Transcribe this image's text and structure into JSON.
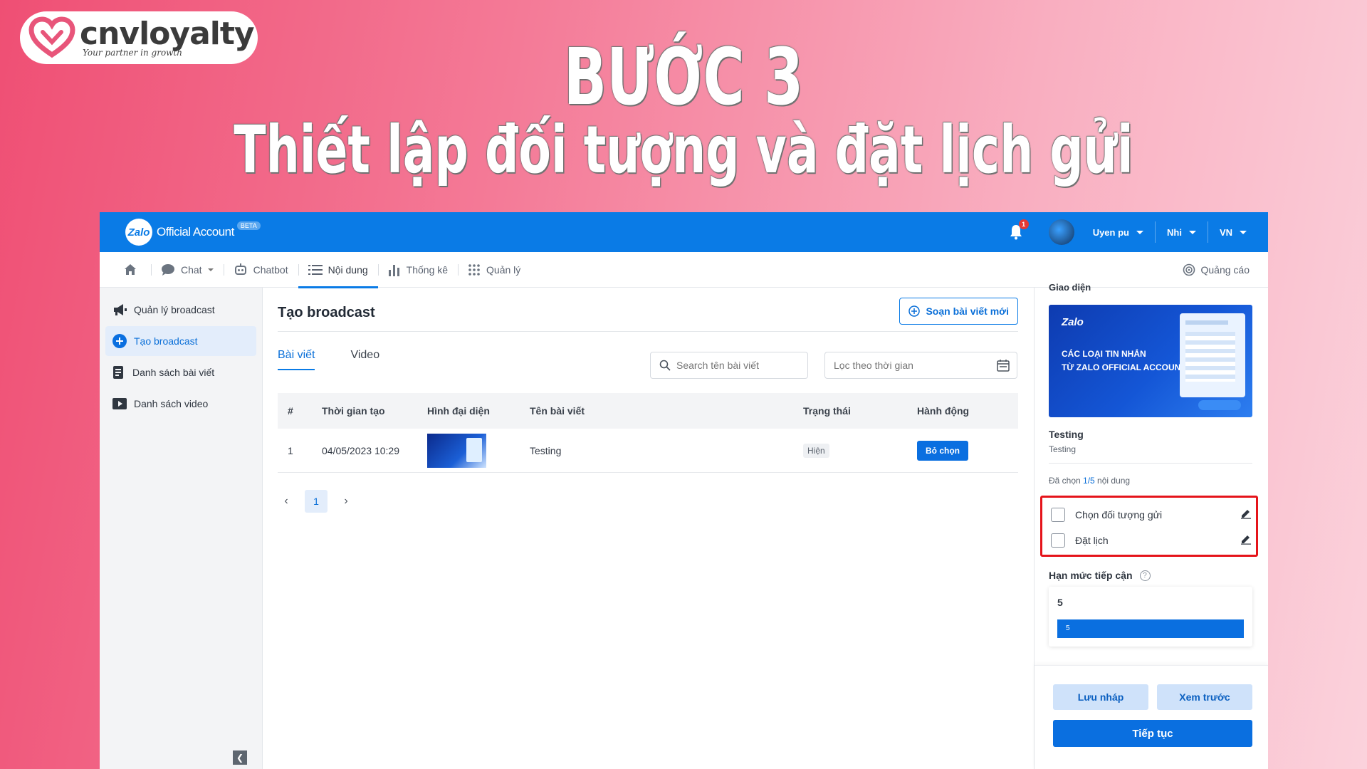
{
  "brand": {
    "name": "cnvloyalty",
    "tagline": "Your partner in growth",
    "accent": "#e8557a"
  },
  "headline": {
    "step": "BƯỚC 3",
    "subtitle": "Thiết lập đối tượng và đặt lịch gửi"
  },
  "app": {
    "topbar": {
      "logo_text": "Zalo",
      "brand_label": "Official Account",
      "beta": "BETA",
      "notification_count": "1",
      "user_name": "Uyen pu",
      "account": "Nhi",
      "language": "VN",
      "color": "#0a7be6"
    },
    "nav": {
      "items": [
        {
          "label": "Chat"
        },
        {
          "label": "Chatbot"
        },
        {
          "label": "Nội dung"
        },
        {
          "label": "Thống kê"
        },
        {
          "label": "Quản lý"
        }
      ],
      "ads": "Quảng cáo"
    },
    "sidebar": {
      "items": [
        {
          "label": "Quản lý broadcast"
        },
        {
          "label": "Tạo broadcast"
        },
        {
          "label": "Danh sách bài viết"
        },
        {
          "label": "Danh sách video"
        }
      ]
    },
    "main": {
      "title": "Tạo broadcast",
      "compose_label": "Soạn bài viết mới",
      "tabs": [
        {
          "label": "Bài viết"
        },
        {
          "label": "Video"
        }
      ],
      "search_placeholder": "Search tên bài viết",
      "date_placeholder": "Lọc theo thời gian",
      "table": {
        "headers": [
          "#",
          "Thời gian tạo",
          "Hình đại diện",
          "Tên bài viết",
          "Trạng thái",
          "Hành động"
        ],
        "rows": [
          {
            "index": "1",
            "created": "04/05/2023 10:29",
            "name": "Testing",
            "status": "Hiện",
            "action": "Bỏ chọn"
          }
        ]
      },
      "pagination": {
        "current": "1"
      }
    },
    "right_panel": {
      "section_clipped": "Giao diện",
      "preview": {
        "brand": "Zalo",
        "line1": "CÁC LOẠI TIN NHẮN",
        "line2": "TỪ ZALO OFFICIAL ACCOUNT"
      },
      "title": "Testing",
      "subtitle": "Testing",
      "selected_prefix": "Đã chọn ",
      "selected_count": "1/5",
      "selected_suffix": " nội dung",
      "options": [
        {
          "label": "Chọn đối tượng gửi",
          "checked": false
        },
        {
          "label": "Đặt lịch",
          "checked": false
        }
      ],
      "reach_title": "Hạn mức tiếp cận",
      "reach_value": "5",
      "reach_bar_value": "5",
      "reach_fill_fraction": 1.0,
      "buttons": {
        "draft": "Lưu nháp",
        "preview": "Xem trước",
        "continue": "Tiếp tục"
      },
      "highlight_color": "#e5141a"
    }
  }
}
